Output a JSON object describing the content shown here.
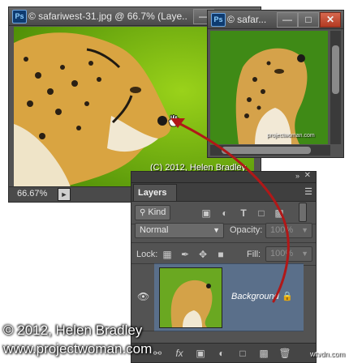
{
  "main_window": {
    "title": "© safariwest-31.jpg @ 66.7% (Laye...",
    "zoom_level": "66.67%",
    "image_caption": "(C) 2012, Helen Bradley",
    "ps_badge": "Ps"
  },
  "second_window": {
    "title": "© safar...",
    "ps_badge": "Ps",
    "image_caption": "projectwoman.com"
  },
  "layers_panel": {
    "tab_label": "Layers",
    "filter_kind": "Kind",
    "blend_mode": "Normal",
    "opacity_label": "Opacity:",
    "opacity_value": "100%",
    "lock_label": "Lock:",
    "fill_label": "Fill:",
    "fill_value": "100%",
    "layers": [
      {
        "name": "Background",
        "visible": true,
        "locked": true
      }
    ]
  },
  "overlay": {
    "copyright": "© 2012, Helen Bradley",
    "website": "www.projectwoman.com",
    "corner_logo": "wtvdn.com"
  },
  "colors": {
    "arrow": "#b01818",
    "layer_selected": "#5a6f8a",
    "panel_bg": "#535353"
  }
}
